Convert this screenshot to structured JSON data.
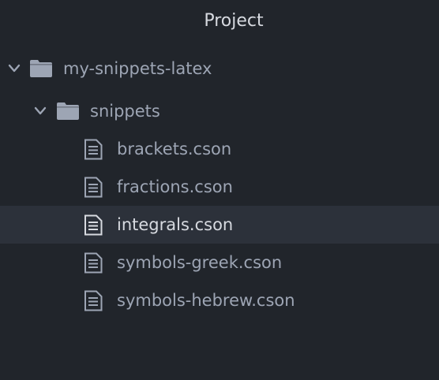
{
  "panel": {
    "title": "Project"
  },
  "tree": {
    "root": {
      "label": "my-snippets-latex",
      "expanded": true,
      "icon": "folder-icon"
    },
    "folder": {
      "label": "snippets",
      "expanded": true,
      "icon": "folder-icon"
    },
    "files": [
      {
        "label": "brackets.cson",
        "selected": false,
        "icon": "file-text-icon"
      },
      {
        "label": "fractions.cson",
        "selected": false,
        "icon": "file-text-icon"
      },
      {
        "label": "integrals.cson",
        "selected": true,
        "icon": "file-text-icon"
      },
      {
        "label": "symbols-greek.cson",
        "selected": false,
        "icon": "file-text-icon"
      },
      {
        "label": "symbols-hebrew.cson",
        "selected": false,
        "icon": "file-text-icon"
      }
    ]
  },
  "colors": {
    "background": "#21252b",
    "selected_row": "#2c313a",
    "text": "#9da5b4",
    "text_selected": "#d7dae0",
    "icon": "#9da5b4"
  }
}
